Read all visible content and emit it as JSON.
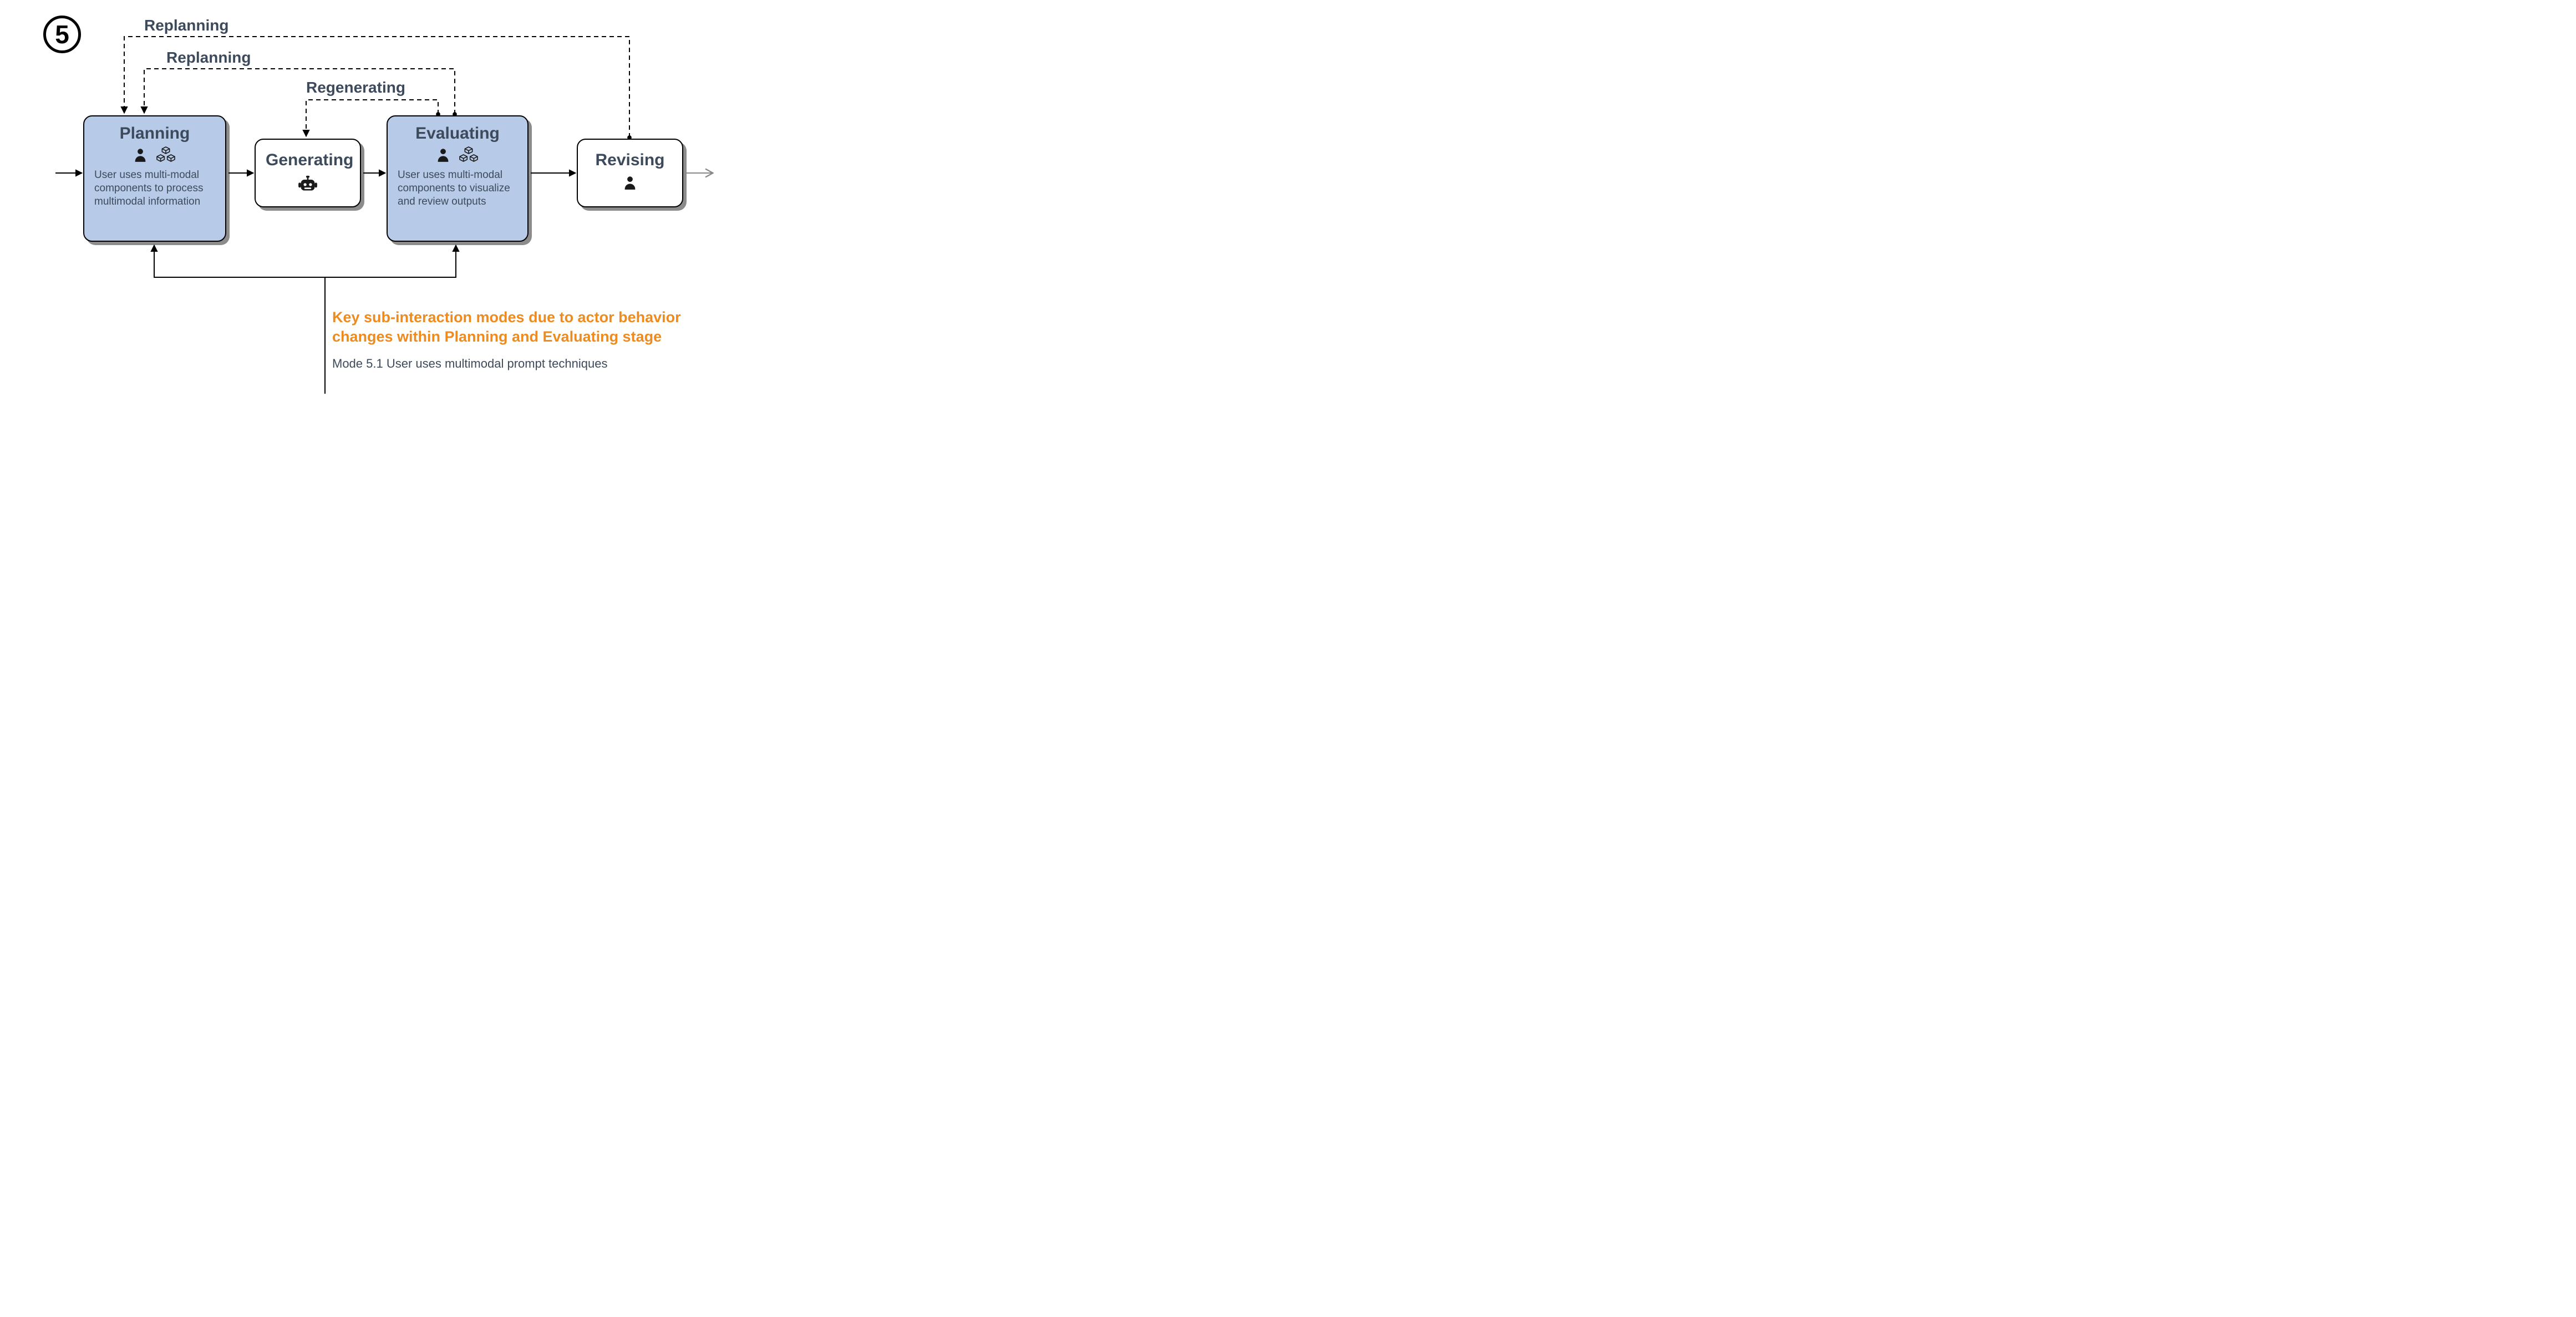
{
  "diagram_number": "5",
  "feedback": {
    "replanning_top": "Replanning",
    "replanning_mid": "Replanning",
    "regenerating": "Regenerating"
  },
  "nodes": {
    "planning": {
      "title": "Planning",
      "desc": "User uses multi-modal components to process multimodal information"
    },
    "generating": {
      "title": "Generating"
    },
    "evaluating": {
      "title": "Evaluating",
      "desc": "User uses multi-modal components to visualize and review outputs"
    },
    "revising": {
      "title": "Revising"
    }
  },
  "annotation": {
    "key_title": "Key sub-interaction modes due to actor behavior changes within Planning and Evaluating stage",
    "mode": "Mode 5.1 User uses multimodal prompt techniques"
  }
}
